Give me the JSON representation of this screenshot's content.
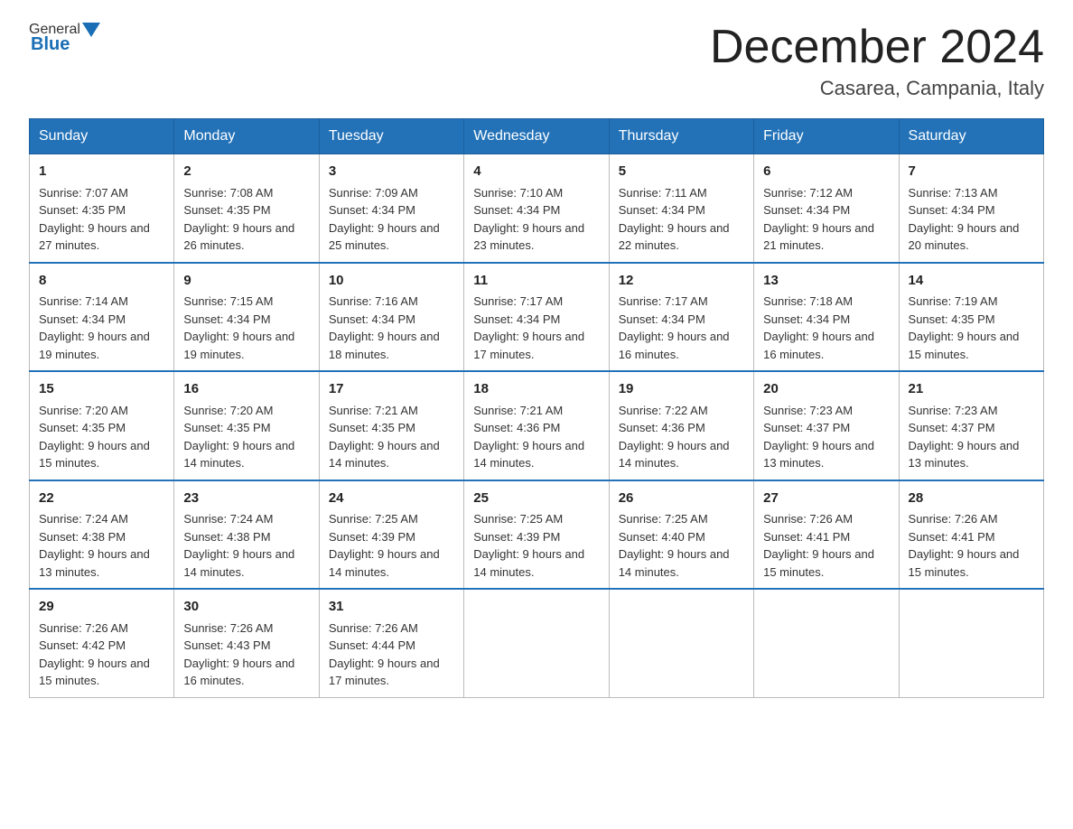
{
  "header": {
    "logo": {
      "general": "General",
      "blue": "Blue"
    },
    "title": "December 2024",
    "location": "Casarea, Campania, Italy"
  },
  "days_of_week": [
    "Sunday",
    "Monday",
    "Tuesday",
    "Wednesday",
    "Thursday",
    "Friday",
    "Saturday"
  ],
  "weeks": [
    [
      {
        "day": "1",
        "sunrise": "Sunrise: 7:07 AM",
        "sunset": "Sunset: 4:35 PM",
        "daylight": "Daylight: 9 hours and 27 minutes."
      },
      {
        "day": "2",
        "sunrise": "Sunrise: 7:08 AM",
        "sunset": "Sunset: 4:35 PM",
        "daylight": "Daylight: 9 hours and 26 minutes."
      },
      {
        "day": "3",
        "sunrise": "Sunrise: 7:09 AM",
        "sunset": "Sunset: 4:34 PM",
        "daylight": "Daylight: 9 hours and 25 minutes."
      },
      {
        "day": "4",
        "sunrise": "Sunrise: 7:10 AM",
        "sunset": "Sunset: 4:34 PM",
        "daylight": "Daylight: 9 hours and 23 minutes."
      },
      {
        "day": "5",
        "sunrise": "Sunrise: 7:11 AM",
        "sunset": "Sunset: 4:34 PM",
        "daylight": "Daylight: 9 hours and 22 minutes."
      },
      {
        "day": "6",
        "sunrise": "Sunrise: 7:12 AM",
        "sunset": "Sunset: 4:34 PM",
        "daylight": "Daylight: 9 hours and 21 minutes."
      },
      {
        "day": "7",
        "sunrise": "Sunrise: 7:13 AM",
        "sunset": "Sunset: 4:34 PM",
        "daylight": "Daylight: 9 hours and 20 minutes."
      }
    ],
    [
      {
        "day": "8",
        "sunrise": "Sunrise: 7:14 AM",
        "sunset": "Sunset: 4:34 PM",
        "daylight": "Daylight: 9 hours and 19 minutes."
      },
      {
        "day": "9",
        "sunrise": "Sunrise: 7:15 AM",
        "sunset": "Sunset: 4:34 PM",
        "daylight": "Daylight: 9 hours and 19 minutes."
      },
      {
        "day": "10",
        "sunrise": "Sunrise: 7:16 AM",
        "sunset": "Sunset: 4:34 PM",
        "daylight": "Daylight: 9 hours and 18 minutes."
      },
      {
        "day": "11",
        "sunrise": "Sunrise: 7:17 AM",
        "sunset": "Sunset: 4:34 PM",
        "daylight": "Daylight: 9 hours and 17 minutes."
      },
      {
        "day": "12",
        "sunrise": "Sunrise: 7:17 AM",
        "sunset": "Sunset: 4:34 PM",
        "daylight": "Daylight: 9 hours and 16 minutes."
      },
      {
        "day": "13",
        "sunrise": "Sunrise: 7:18 AM",
        "sunset": "Sunset: 4:34 PM",
        "daylight": "Daylight: 9 hours and 16 minutes."
      },
      {
        "day": "14",
        "sunrise": "Sunrise: 7:19 AM",
        "sunset": "Sunset: 4:35 PM",
        "daylight": "Daylight: 9 hours and 15 minutes."
      }
    ],
    [
      {
        "day": "15",
        "sunrise": "Sunrise: 7:20 AM",
        "sunset": "Sunset: 4:35 PM",
        "daylight": "Daylight: 9 hours and 15 minutes."
      },
      {
        "day": "16",
        "sunrise": "Sunrise: 7:20 AM",
        "sunset": "Sunset: 4:35 PM",
        "daylight": "Daylight: 9 hours and 14 minutes."
      },
      {
        "day": "17",
        "sunrise": "Sunrise: 7:21 AM",
        "sunset": "Sunset: 4:35 PM",
        "daylight": "Daylight: 9 hours and 14 minutes."
      },
      {
        "day": "18",
        "sunrise": "Sunrise: 7:21 AM",
        "sunset": "Sunset: 4:36 PM",
        "daylight": "Daylight: 9 hours and 14 minutes."
      },
      {
        "day": "19",
        "sunrise": "Sunrise: 7:22 AM",
        "sunset": "Sunset: 4:36 PM",
        "daylight": "Daylight: 9 hours and 14 minutes."
      },
      {
        "day": "20",
        "sunrise": "Sunrise: 7:23 AM",
        "sunset": "Sunset: 4:37 PM",
        "daylight": "Daylight: 9 hours and 13 minutes."
      },
      {
        "day": "21",
        "sunrise": "Sunrise: 7:23 AM",
        "sunset": "Sunset: 4:37 PM",
        "daylight": "Daylight: 9 hours and 13 minutes."
      }
    ],
    [
      {
        "day": "22",
        "sunrise": "Sunrise: 7:24 AM",
        "sunset": "Sunset: 4:38 PM",
        "daylight": "Daylight: 9 hours and 13 minutes."
      },
      {
        "day": "23",
        "sunrise": "Sunrise: 7:24 AM",
        "sunset": "Sunset: 4:38 PM",
        "daylight": "Daylight: 9 hours and 14 minutes."
      },
      {
        "day": "24",
        "sunrise": "Sunrise: 7:25 AM",
        "sunset": "Sunset: 4:39 PM",
        "daylight": "Daylight: 9 hours and 14 minutes."
      },
      {
        "day": "25",
        "sunrise": "Sunrise: 7:25 AM",
        "sunset": "Sunset: 4:39 PM",
        "daylight": "Daylight: 9 hours and 14 minutes."
      },
      {
        "day": "26",
        "sunrise": "Sunrise: 7:25 AM",
        "sunset": "Sunset: 4:40 PM",
        "daylight": "Daylight: 9 hours and 14 minutes."
      },
      {
        "day": "27",
        "sunrise": "Sunrise: 7:26 AM",
        "sunset": "Sunset: 4:41 PM",
        "daylight": "Daylight: 9 hours and 15 minutes."
      },
      {
        "day": "28",
        "sunrise": "Sunrise: 7:26 AM",
        "sunset": "Sunset: 4:41 PM",
        "daylight": "Daylight: 9 hours and 15 minutes."
      }
    ],
    [
      {
        "day": "29",
        "sunrise": "Sunrise: 7:26 AM",
        "sunset": "Sunset: 4:42 PM",
        "daylight": "Daylight: 9 hours and 15 minutes."
      },
      {
        "day": "30",
        "sunrise": "Sunrise: 7:26 AM",
        "sunset": "Sunset: 4:43 PM",
        "daylight": "Daylight: 9 hours and 16 minutes."
      },
      {
        "day": "31",
        "sunrise": "Sunrise: 7:26 AM",
        "sunset": "Sunset: 4:44 PM",
        "daylight": "Daylight: 9 hours and 17 minutes."
      },
      null,
      null,
      null,
      null
    ]
  ]
}
